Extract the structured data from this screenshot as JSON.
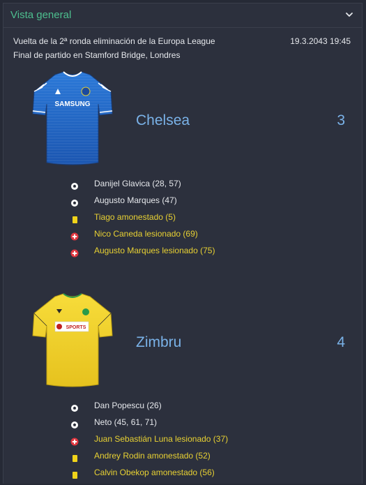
{
  "panel": {
    "title": "Vista general",
    "collapse_icon": "chevron-down-icon"
  },
  "match": {
    "description": "Vuelta de la 2ª ronda eliminación de la Europa League",
    "venue": "Final de partido en Stamford Bridge, Londres",
    "datetime": "19.3.2043 19:45"
  },
  "colors": {
    "accent_green": "#4dbf8f",
    "team_blue": "#7ab2e8",
    "event_yellow": "#e8d133",
    "text_white": "#e6e8ec",
    "injury_red": "#e0363f",
    "card_yellow": "#f0d31a"
  },
  "teams": [
    {
      "name": "Chelsea",
      "score": "3",
      "kit_colors": {
        "primary": "#1c5fc2",
        "secondary": "#ffffff"
      },
      "sponsor": "SAMSUNG",
      "events": [
        {
          "icon": "ball-icon",
          "type": "goal",
          "text": "Danijel Glavica (28, 57)"
        },
        {
          "icon": "ball-icon",
          "type": "goal",
          "text": "Augusto Marques (47)"
        },
        {
          "icon": "yellow-card-icon",
          "type": "booking",
          "text": "Tiago amonestado (5)"
        },
        {
          "icon": "injury-icon",
          "type": "injury",
          "text": "Nico Caneda lesionado (69)"
        },
        {
          "icon": "injury-icon",
          "type": "injury",
          "text": "Augusto Marques lesionado (75)"
        }
      ]
    },
    {
      "name": "Zimbru",
      "score": "4",
      "kit_colors": {
        "primary": "#f2d22e",
        "secondary": "#2a9a4a"
      },
      "sponsor": "SPORTS",
      "events": [
        {
          "icon": "ball-icon",
          "type": "goal",
          "text": "Dan Popescu (26)"
        },
        {
          "icon": "ball-icon",
          "type": "goal",
          "text": "Neto (45, 61, 71)"
        },
        {
          "icon": "injury-icon",
          "type": "injury",
          "text": "Juan Sebastián Luna lesionado (37)"
        },
        {
          "icon": "yellow-card-icon",
          "type": "booking",
          "text": "Andrey Rodin amonestado (52)"
        },
        {
          "icon": "yellow-card-icon",
          "type": "booking",
          "text": "Calvin Obekop amonestado (56)"
        }
      ]
    }
  ]
}
